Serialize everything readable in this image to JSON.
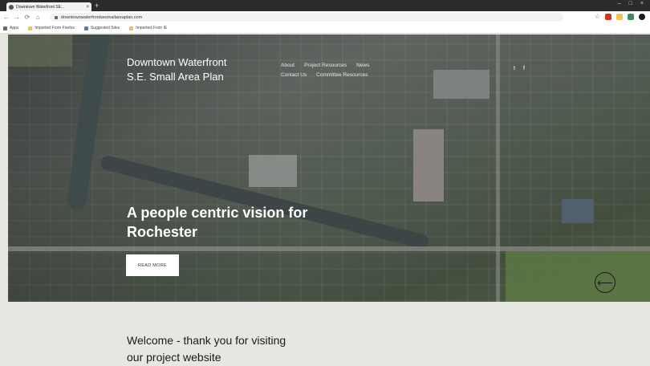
{
  "browser": {
    "tab_title": "Downtown Waterfront SE...",
    "tab_close": "×",
    "new_tab": "+",
    "window_controls": [
      "–",
      "□",
      "×"
    ],
    "nav": {
      "back": "←",
      "forward": "→",
      "reload": "⟳",
      "home": "⌂"
    },
    "url": "downtownwaterfrontsesmallareaplan.com",
    "bookmarks": [
      {
        "label": "Apps",
        "color": "#6a6a6a"
      },
      {
        "label": "Imported From Firefox",
        "color": "#f2c14e"
      },
      {
        "label": "Suggested Sites",
        "color": "#4a7bd1"
      },
      {
        "label": "Imported From IE",
        "color": "#f2c14e"
      }
    ],
    "extension_colors": [
      "#d93025",
      "#f2c14e",
      "#3c8d5a",
      "#1a1a1a"
    ],
    "star_icon": "☆"
  },
  "site": {
    "brand_line1": "Downtown Waterfront",
    "brand_line2": "S.E. Small Area Plan",
    "nav_row1": [
      "About",
      "Project Resources",
      "News"
    ],
    "nav_row2": [
      "Contact Us",
      "Committee Resources"
    ],
    "social_icons": [
      "twitter-icon",
      "facebook-icon"
    ],
    "social_glyphs": [
      "t",
      "f"
    ],
    "headline_line1": "A people centric vision for",
    "headline_line2": "Rochester",
    "cta_label": "READ MORE",
    "prev_glyph": "⟵",
    "welcome_line1": "Welcome - thank you for visiting",
    "welcome_line2": "our project website"
  }
}
